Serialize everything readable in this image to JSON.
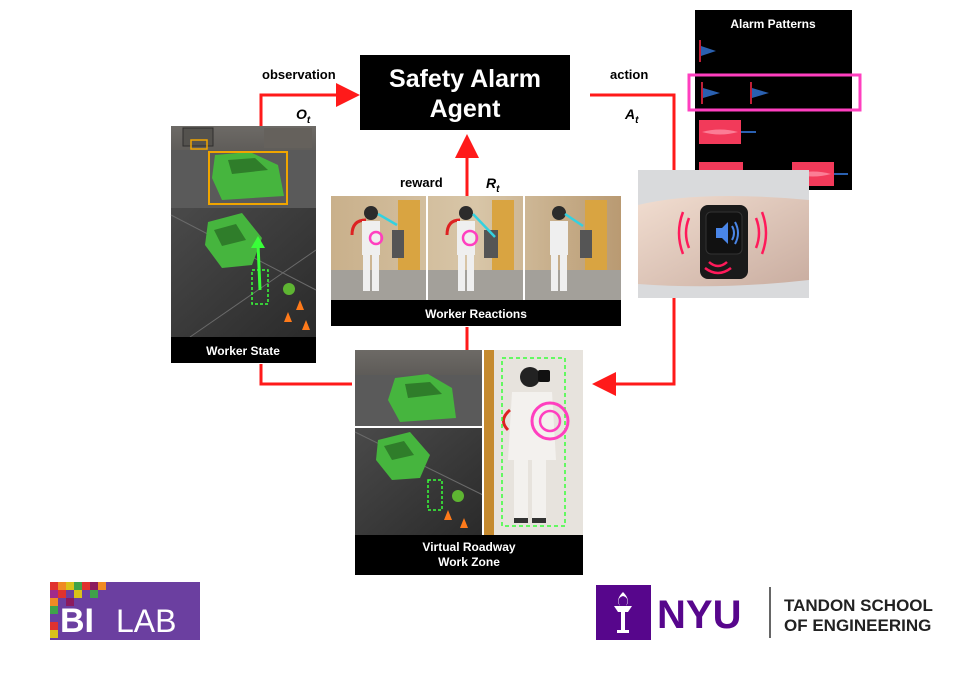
{
  "nodes": {
    "agent": {
      "line1": "Safety Alarm",
      "line2": "Agent"
    },
    "alarm_patterns": {
      "title": "Alarm Patterns"
    },
    "worker_reactions": {
      "caption": "Worker Reactions"
    },
    "worker_state": {
      "caption": "Worker State"
    },
    "work_zone": {
      "line1": "Virtual Roadway",
      "line2": "Work Zone"
    }
  },
  "edges": {
    "observation": {
      "label": "observation",
      "symbol": "O",
      "subscript": "t"
    },
    "action": {
      "label": "action",
      "symbol": "A",
      "subscript": "t"
    },
    "reward": {
      "label": "reward",
      "symbol": "R",
      "subscript": "t"
    }
  },
  "logos": {
    "bilab": {
      "text_b": "BI",
      "text_lab": "LAB"
    },
    "nyu": {
      "text": "NYU",
      "line1": "TANDON SCHOOL",
      "line2": "OF ENGINEERING"
    }
  },
  "colors": {
    "arrow": "#ff1a1a",
    "highlight": "#ff3fbf",
    "bilab_purple": "#6b3fa0",
    "nyu_purple": "#57068c"
  }
}
